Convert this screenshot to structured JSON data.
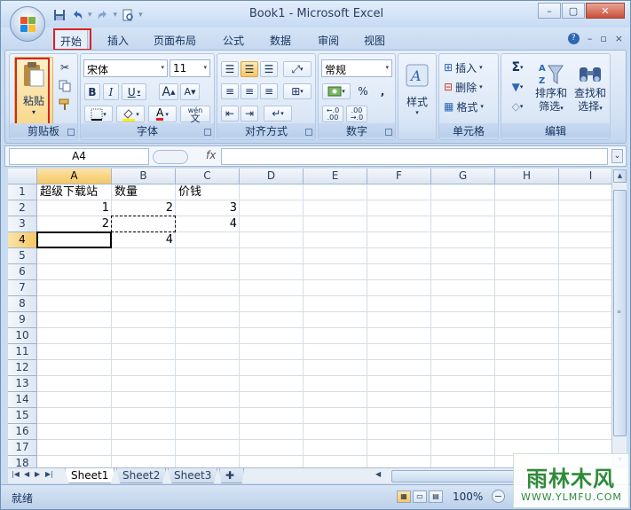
{
  "window": {
    "title": "Book1 - Microsoft Excel",
    "controls": {
      "minimize": "–",
      "restore": "▢",
      "close": "✕"
    },
    "orb_icon": "office-logo-icon"
  },
  "qat": {
    "save": "save-icon",
    "undo": "undo-icon",
    "redo": "redo-icon",
    "print_preview": "print-preview-icon",
    "more": "▾"
  },
  "tabs": [
    {
      "label": "开始",
      "active": true
    },
    {
      "label": "插入"
    },
    {
      "label": "页面布局"
    },
    {
      "label": "公式"
    },
    {
      "label": "数据"
    },
    {
      "label": "审阅"
    },
    {
      "label": "视图"
    }
  ],
  "ribbon": {
    "clipboard": {
      "label": "剪贴板",
      "paste_label": "粘贴",
      "paste_arrow": "▾"
    },
    "font": {
      "label": "字体",
      "font_name": "宋体",
      "font_size": "11",
      "bold": "B",
      "italic": "I",
      "underline": "U",
      "grow": "A",
      "shrink": "A",
      "font_color_letter": "A",
      "phonetic": "wén",
      "phonetic_char": "文"
    },
    "alignment": {
      "label": "对齐方式"
    },
    "number": {
      "label": "数字",
      "format": "常规",
      "percent": "%",
      "comma": ",",
      "inc_decimal": ".00",
      "dec_decimal": ".00"
    },
    "styles": {
      "label": "样式"
    },
    "cells": {
      "label": "单元格",
      "insert": "插入",
      "delete": "删除",
      "format": "格式"
    },
    "editing": {
      "label": "编辑",
      "sigma": "Σ",
      "sort_filter_1": "排序和",
      "sort_filter_2": "筛选",
      "find_select_1": "查找和",
      "find_select_2": "选择"
    }
  },
  "formula_bar": {
    "name_box": "A4",
    "fx": "fx",
    "formula": ""
  },
  "sheet": {
    "columns": [
      "A",
      "B",
      "C",
      "D",
      "E",
      "F",
      "G",
      "H",
      "I"
    ],
    "rows": [
      "1",
      "2",
      "3",
      "4",
      "5",
      "6",
      "7",
      "8",
      "9",
      "10",
      "11",
      "12",
      "13",
      "14",
      "15",
      "16",
      "17",
      "18"
    ],
    "cells": {
      "A1": "超级下载站",
      "B1": "数量",
      "C1": "价钱",
      "A2": "1",
      "B2": "2",
      "C2": "3",
      "A3": "2",
      "C3": "4",
      "B4": "4"
    },
    "selected_cell": "A4",
    "copy_range": "B3"
  },
  "sheet_tabs": [
    {
      "label": "Sheet1",
      "active": true
    },
    {
      "label": "Sheet2"
    },
    {
      "label": "Sheet3"
    }
  ],
  "status_bar": {
    "ready": "就绪",
    "zoom": "100%",
    "zoom_out": "−"
  },
  "watermark": {
    "name": "雨林木风",
    "url": "WWW.YLMFU.COM"
  }
}
